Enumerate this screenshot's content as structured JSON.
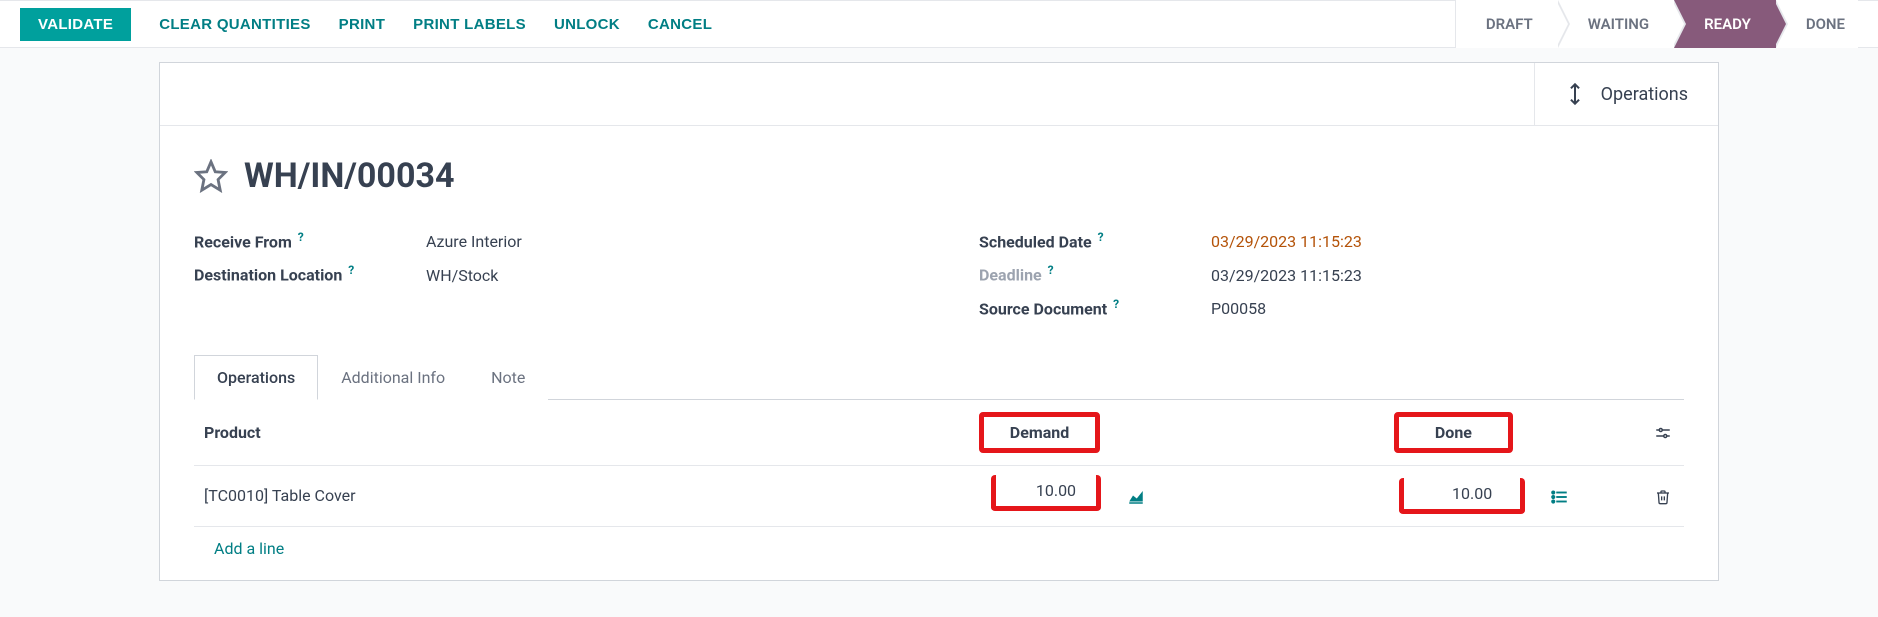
{
  "actions": {
    "validate": "VALIDATE",
    "clear_quantities": "CLEAR QUANTITIES",
    "print": "PRINT",
    "print_labels": "PRINT LABELS",
    "unlock": "UNLOCK",
    "cancel": "CANCEL"
  },
  "status": {
    "draft": "DRAFT",
    "waiting": "WAITING",
    "ready": "READY",
    "done": "DONE"
  },
  "stat_buttons": {
    "operations": "Operations"
  },
  "document": {
    "name": "WH/IN/00034",
    "fields": {
      "receive_from_label": "Receive From",
      "receive_from_value": "Azure Interior",
      "destination_label": "Destination Location",
      "destination_value": "WH/Stock",
      "scheduled_label": "Scheduled Date",
      "scheduled_value": "03/29/2023 11:15:23",
      "deadline_label": "Deadline",
      "deadline_value": "03/29/2023 11:15:23",
      "source_doc_label": "Source Document",
      "source_doc_value": "P00058"
    }
  },
  "tabs": {
    "operations": "Operations",
    "additional_info": "Additional Info",
    "note": "Note"
  },
  "table": {
    "headers": {
      "product": "Product",
      "demand": "Demand",
      "done": "Done"
    },
    "rows": [
      {
        "product": "[TC0010] Table Cover",
        "demand": "10.00",
        "done": "10.00"
      }
    ],
    "add_line": "Add a line"
  },
  "help_marker": "?"
}
